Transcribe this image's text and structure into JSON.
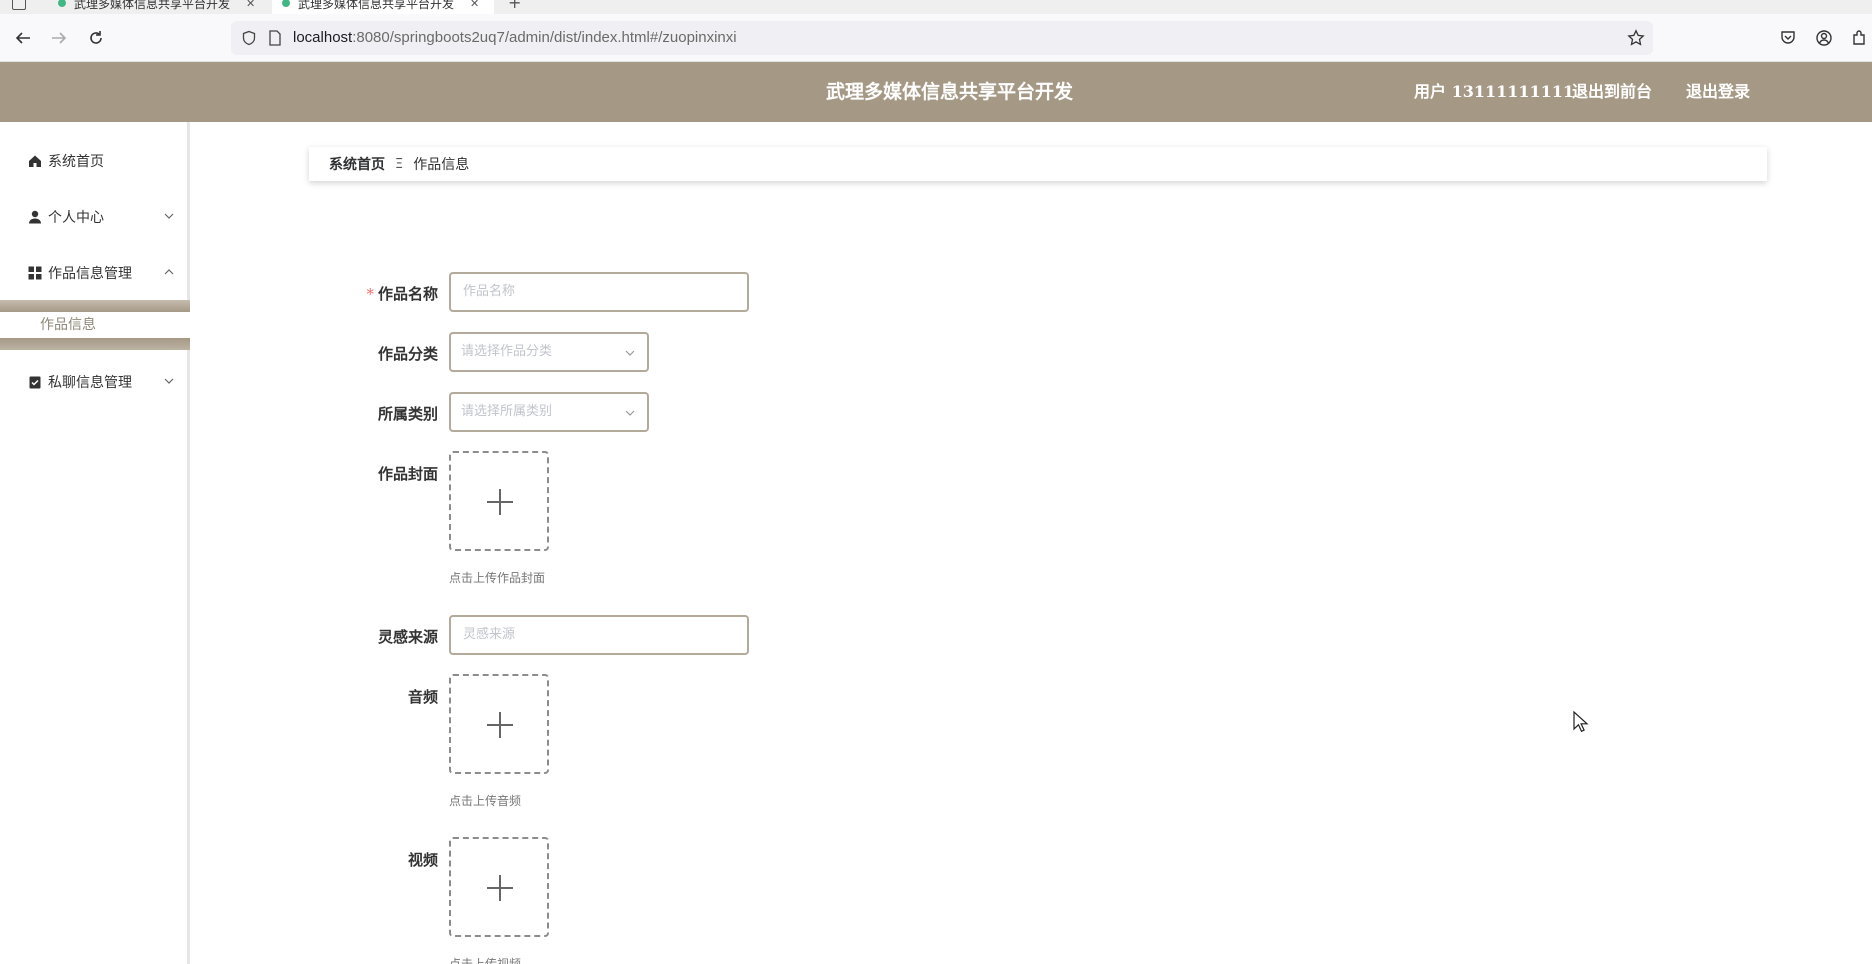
{
  "browser": {
    "tabs": [
      {
        "title": "武理多媒体信息共享平台开发"
      },
      {
        "title": "武理多媒体信息共享平台开发"
      }
    ],
    "url_host": "localhost",
    "url_rest": ":8080/springboots2uq7/admin/dist/index.html#/zuopinxinxi"
  },
  "header": {
    "title": "武理多媒体信息共享平台开发",
    "user": "用户 13111111111",
    "front_label": "退出到前台",
    "logout_label": "退出登录",
    "bg_color": "#a59986"
  },
  "sidebar": {
    "items": [
      {
        "label": "系统首页",
        "icon": "home-icon"
      },
      {
        "label": "个人中心",
        "icon": "user-icon"
      },
      {
        "label": "作品信息管理",
        "icon": "grid-icon"
      },
      {
        "label": "私聊信息管理",
        "icon": "clipboard-icon"
      }
    ],
    "subitem": "作品信息"
  },
  "breadcrumb": {
    "home": "系统首页",
    "separator": "Ξ",
    "current": "作品信息"
  },
  "form": {
    "name_label": "作品名称",
    "name_required": "*",
    "name_placeholder": "作品名称",
    "category_label": "作品分类",
    "category_placeholder": "请选择作品分类",
    "type_label": "所属类别",
    "type_placeholder": "请选择所属类别",
    "cover_label": "作品封面",
    "cover_tip": "点击上传作品封面",
    "inspiration_label": "灵感来源",
    "inspiration_placeholder": "灵感来源",
    "audio_label": "音频",
    "audio_tip": "点击上传音频",
    "video_label": "视频",
    "video_tip": "点击上传视频"
  }
}
